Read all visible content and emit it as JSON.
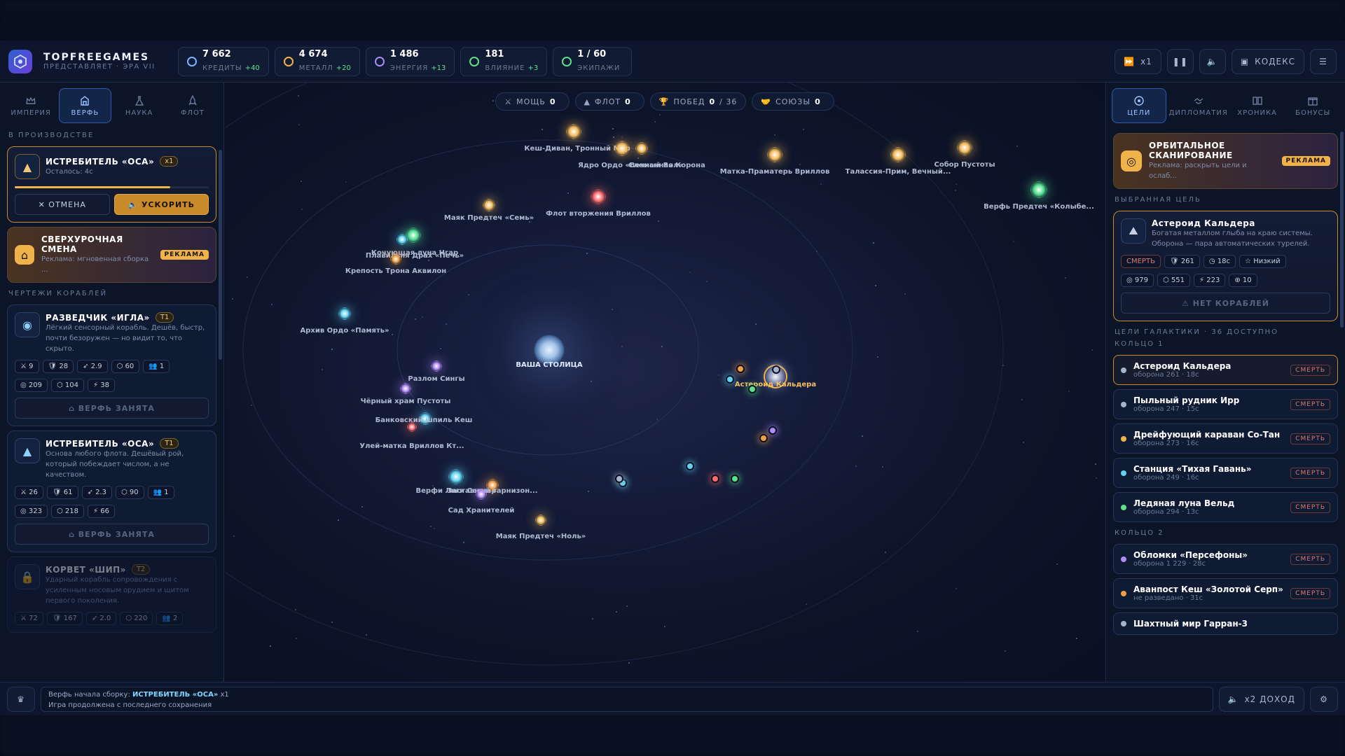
{
  "app": {
    "brand": "TOPFREEGAMES",
    "subtitle": "ПРЕДСТАВЛЯЕТ · ЭРА VII"
  },
  "resources": [
    {
      "icon": "credits-icon",
      "value": "7 662",
      "label": "КРЕДИТЫ",
      "delta": "+40",
      "color": "#7db3ff"
    },
    {
      "icon": "metal-icon",
      "value": "4 674",
      "label": "МЕТАЛЛ",
      "delta": "+20",
      "color": "#f0b34a"
    },
    {
      "icon": "energy-icon",
      "value": "1 486",
      "label": "ЭНЕРГИЯ",
      "delta": "+13",
      "color": "#a78bfa"
    },
    {
      "icon": "influence-icon",
      "value": "181",
      "label": "ВЛИЯНИЕ",
      "delta": "+3",
      "color": "#5ee08b"
    },
    {
      "icon": "crews-icon",
      "value": "1 / 60",
      "label": "ЭКИПАЖИ",
      "delta": "",
      "color": "#5ee08b"
    }
  ],
  "topright": {
    "speed": "x1",
    "codex": "КОДЕКС"
  },
  "left": {
    "tabs": [
      "ИМПЕРИЯ",
      "ВЕРФЬ",
      "НАУКА",
      "ФЛОТ"
    ],
    "in_production": "В ПРОИЗВОДСТВЕ",
    "prod": {
      "name": "ИСТРЕБИТЕЛЬ «ОСА»",
      "qty": "x1",
      "remaining": "Осталось: 4с",
      "cancel": "ОТМЕНА",
      "speed": "УСКОРИТЬ",
      "progress": 0.8
    },
    "overtime": {
      "title": "СВЕРХУРОЧНАЯ СМЕНА",
      "desc": "Реклама: мгновенная сборка ...",
      "ad": "РЕКЛАМА"
    },
    "blueprints": "ЧЕРТЕЖИ КОРАБЛЕЙ",
    "ships": [
      {
        "name": "РАЗВЕДЧИК «ИГЛА»",
        "tier": "T1",
        "desc": "Лёгкий сенсорный корабль. Дешёв, быстр, почти безоружен — но видит то, что скрыто.",
        "stats": [
          "9",
          "28",
          "2.9",
          "60",
          "1"
        ],
        "cost": [
          "209",
          "104",
          "38"
        ],
        "button": "ВЕРФЬ ЗАНЯТА"
      },
      {
        "name": "ИСТРЕБИТЕЛЬ «ОСА»",
        "tier": "T1",
        "desc": "Основа любого флота. Дешёвый рой, который побеждает числом, а не качеством.",
        "stats": [
          "26",
          "61",
          "2.3",
          "90",
          "1"
        ],
        "cost": [
          "323",
          "218",
          "66"
        ],
        "button": "ВЕРФЬ ЗАНЯТА"
      },
      {
        "name": "КОРВЕТ «ШИП»",
        "tier": "T2",
        "desc": "Ударный корабль сопровождения с усиленным носовым орудием и щитом первого поколения.",
        "stats": [
          "72",
          "167",
          "2.0",
          "220",
          "2"
        ],
        "cost": [],
        "button": ""
      }
    ]
  },
  "map": {
    "stats": [
      {
        "label": "МОЩЬ",
        "value": "0",
        "extra": ""
      },
      {
        "label": "ФЛОТ",
        "value": "0",
        "extra": ""
      },
      {
        "label": "ПОБЕД",
        "value": "0",
        "extra": "/ 36"
      },
      {
        "label": "СОЮЗЫ",
        "value": "0",
        "extra": ""
      }
    ],
    "capital": "ВАША СТОЛИЦА",
    "labels": [
      "Собор Пустоты",
      "Кеш-Диван, Тронный Мир",
      "Ядро Ордо «Вечный Вол»",
      "Сломанная Корона",
      "Матка-Праматерь Вриллов",
      "Талассия-Прим, Вечный...",
      "Верфь Предтеч «Колыбе...",
      "Маяк Предтеч «Семь»",
      "Флот вторжения Вриллов",
      "Кочующая луна Нгар",
      "Плавильня Драх «Печь»",
      "Крепость Трона Аквилон",
      "Архив Ордо «Память»",
      "Разлом Сингы",
      "Чёрный храм Пустоты",
      "Банковский шпиль Кеш",
      "Улей-матка Вриллов Кт...",
      "Верфи Лиги Сетмар",
      "Заставный гарнизон...",
      "Сад Хранителей",
      "Маяк Предтеч «Ноль»",
      "Астероид Кальдера",
      "Син"
    ]
  },
  "right": {
    "tabs": [
      "ЦЕЛИ",
      "ДИПЛОМАТИЯ",
      "ХРОНИКА",
      "БОНУСЫ"
    ],
    "scan": {
      "title": "ОРБИТАЛЬНОЕ СКАНИРОВАНИЕ",
      "desc": "Реклама: раскрыть цели и ослаб...",
      "ad": "РЕКЛАМА"
    },
    "selected_title": "ВЫБРАННАЯ ЦЕЛЬ",
    "selected": {
      "name": "Астероид Кальдера",
      "desc": "Богатая металлом глыба на краю системы. Оборона — пара автоматических турелей.",
      "risk": "СМЕРТЬ",
      "def": "261",
      "time": "18с",
      "tier": "Низкий",
      "loot": [
        "979",
        "551",
        "223",
        "10"
      ],
      "button": "НЕТ КОРАБЛЕЙ"
    },
    "galaxy_title": "ЦЕЛИ ГАЛАКТИКИ · 36 ДОСТУПНО",
    "ring1": "КОЛЬЦО 1",
    "ring2": "КОЛЬЦО 2",
    "targets1": [
      {
        "name": "Астероид Кальдера",
        "sub": "оборона 261 · 18с",
        "risk": "СМЕРТЬ",
        "color": "#a8b3cc"
      },
      {
        "name": "Пыльный рудник Ирр",
        "sub": "оборона 247 · 15с",
        "risk": "СМЕРТЬ",
        "color": "#a8b3cc"
      },
      {
        "name": "Дрейфующий караван Со-Тан",
        "sub": "оборона 273 · 16с",
        "risk": "СМЕРТЬ",
        "color": "#f0b34a"
      },
      {
        "name": "Станция «Тихая Гавань»",
        "sub": "оборона 249 · 16с",
        "risk": "СМЕРТЬ",
        "color": "#5fd3f0"
      },
      {
        "name": "Ледяная луна Вельд",
        "sub": "оборона 294 · 13с",
        "risk": "СМЕРТЬ",
        "color": "#5ee08b"
      }
    ],
    "targets2": [
      {
        "name": "Обломки «Персефоны»",
        "sub": "оборона 1 229 · 28с",
        "risk": "СМЕРТЬ",
        "color": "#b18cf5"
      },
      {
        "name": "Аванпост Кеш «Золотой Серп»",
        "sub": "не разведано · 31с",
        "risk": "СМЕРТЬ",
        "color": "#f0a040"
      },
      {
        "name": "Шахтный мир Гарран-3",
        "sub": "",
        "risk": "",
        "color": "#a8b3cc"
      }
    ]
  },
  "bottom": {
    "log_prefix": "Верфь начала сборку:",
    "log_ship": "ИСТРЕБИТЕЛЬ «ОСА»",
    "log_qty": "x1",
    "log_line2": "Игра продолжена с последнего сохранения",
    "income": "x2 ДОХОД"
  }
}
